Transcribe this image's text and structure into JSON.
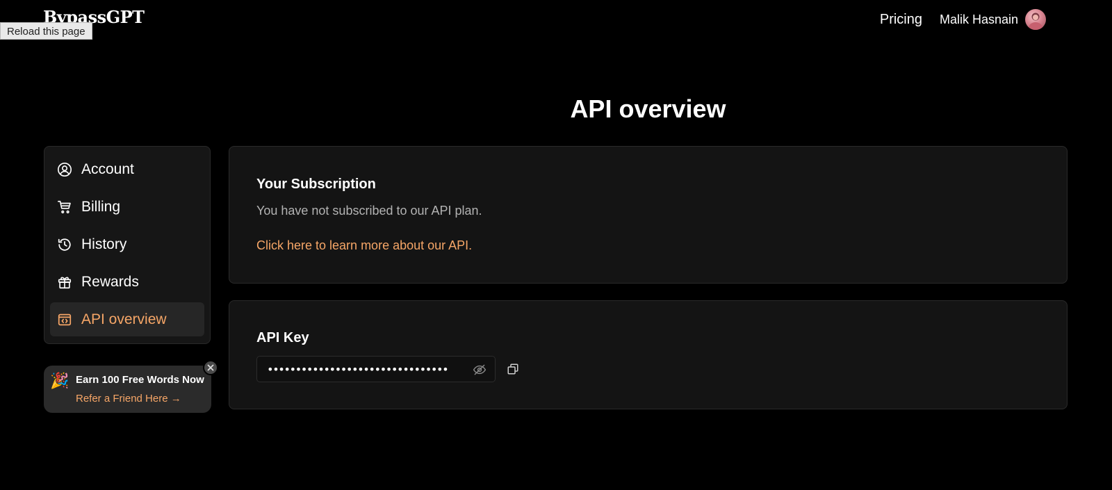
{
  "header": {
    "logo_text": "BypassGPT",
    "tooltip": "Reload this page",
    "nav_pricing": "Pricing",
    "user_name": "Malik Hasnain"
  },
  "page": {
    "title": "API overview"
  },
  "sidebar": {
    "items": [
      {
        "label": "Account",
        "icon": "user-circle-icon"
      },
      {
        "label": "Billing",
        "icon": "cart-icon"
      },
      {
        "label": "History",
        "icon": "history-icon"
      },
      {
        "label": "Rewards",
        "icon": "gift-icon"
      },
      {
        "label": "API overview",
        "icon": "code-window-icon",
        "active": true
      }
    ]
  },
  "promo": {
    "title": "Earn 100 Free Words Now",
    "link": "Refer a Friend Here →",
    "emoji": "🎉"
  },
  "subscription": {
    "heading": "Your Subscription",
    "status": "You have not subscribed to our API plan.",
    "link": "Click here to learn more about our API."
  },
  "api_key": {
    "heading": "API Key",
    "masked_value": "••••••••••••••••••••••••••••••••"
  },
  "colors": {
    "accent": "#f6a667",
    "card_bg": "#141414",
    "bg": "#000000"
  }
}
